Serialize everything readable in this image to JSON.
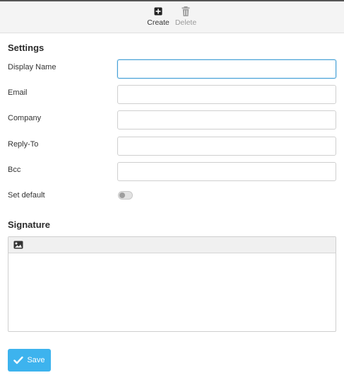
{
  "toolbar": {
    "create_label": "Create",
    "delete_label": "Delete",
    "create_icon": "plus-square-icon",
    "delete_icon": "trash-icon"
  },
  "settings": {
    "title": "Settings",
    "fields": [
      {
        "label": "Display Name",
        "value": "",
        "placeholder": ""
      },
      {
        "label": "Email",
        "value": "",
        "placeholder": ""
      },
      {
        "label": "Company",
        "value": "",
        "placeholder": ""
      },
      {
        "label": "Reply-To",
        "value": "",
        "placeholder": ""
      },
      {
        "label": "Bcc",
        "value": "",
        "placeholder": ""
      }
    ],
    "default_label": "Set default",
    "default_on": false
  },
  "signature": {
    "title": "Signature",
    "image_icon": "image-icon",
    "content": ""
  },
  "actions": {
    "save_label": "Save",
    "save_icon": "checkmark-icon",
    "accent": "#3db3ee"
  }
}
